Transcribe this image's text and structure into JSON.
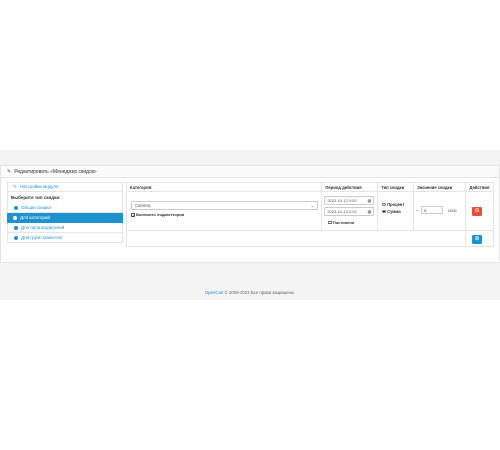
{
  "panel": {
    "title": "Редактировать «Менеджер скидок»"
  },
  "sidebar": {
    "settings_link": "Настройки модуля",
    "choose_label": "Выберите тип скидки:",
    "items": [
      {
        "label": "Общая скидка"
      },
      {
        "label": "Для категорий"
      },
      {
        "label": "Для производителей"
      },
      {
        "label": "Для групп клиентов"
      }
    ]
  },
  "table": {
    "headers": {
      "category": "Категория:",
      "period": "Период действия",
      "type": "Тип скидки",
      "value": "Значение скидки",
      "actions": "Действия"
    },
    "row": {
      "category_value": "Camera",
      "include_subcats": "Включить подкатегории",
      "date_start": "2023-10-12 0:52",
      "date_end": "2023-10-13 0:52",
      "permanent": "Постоянно",
      "type_percent": "Процент",
      "type_sum": "Сумма",
      "value_sign": "−",
      "value": "5",
      "currency": "USD"
    }
  },
  "footer": {
    "link": "OpenCart",
    "text": " © 2009-2023 Все права защищены."
  },
  "colors": {
    "accent": "#1e91cf",
    "danger": "#e74c3c"
  }
}
